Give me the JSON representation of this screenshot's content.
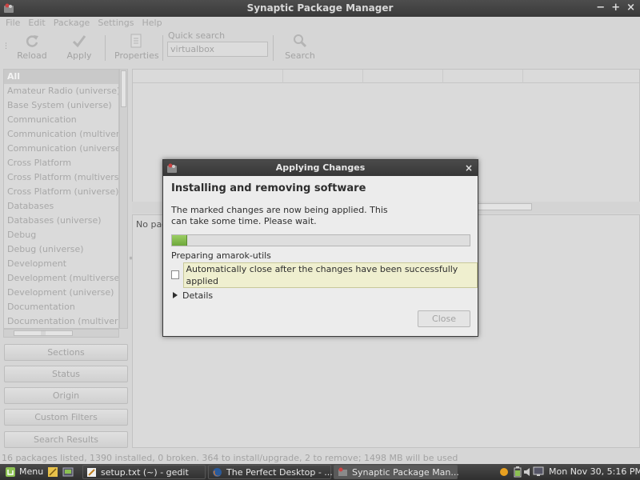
{
  "window": {
    "title": "Synaptic Package Manager",
    "controls": [
      "−",
      "+",
      "×"
    ]
  },
  "menu": [
    "File",
    "Edit",
    "Package",
    "Settings",
    "Help"
  ],
  "toolbar": {
    "reload": "Reload",
    "apply": "Apply",
    "properties": "Properties",
    "quick_search_label": "Quick search",
    "quick_search_value": "virtualbox",
    "search": "Search"
  },
  "sections_list": [
    "All",
    "Amateur Radio (universe)",
    "Base System (universe)",
    "Communication",
    "Communication (multiverse)",
    "Communication (universe)",
    "Cross Platform",
    "Cross Platform (multiverse)",
    "Cross Platform (universe)",
    "Databases",
    "Databases (universe)",
    "Debug",
    "Debug (universe)",
    "Development",
    "Development (multiverse)",
    "Development (universe)",
    "Documentation",
    "Documentation (multiverse)"
  ],
  "side_buttons": {
    "sections": "Sections",
    "status": "Status",
    "origin": "Origin",
    "custom_filters": "Custom Filters",
    "search_results": "Search Results"
  },
  "desc_panel": {
    "text": "No pac"
  },
  "status_bar": "16 packages listed, 1390 installed, 0 broken. 364 to install/upgrade, 2 to remove; 1498 MB will be used",
  "dialog": {
    "title": "Applying Changes",
    "heading": "Installing and removing software",
    "message": "The marked changes are now being applied. This can take some time. Please wait.",
    "progress": 0.05,
    "progress_text": "Preparing amarok-utils",
    "auto_close_label": "Automatically close after the changes have been successfully applied",
    "auto_close_checked": false,
    "details_label": "Details",
    "close_button": "Close"
  },
  "taskbar": {
    "menu": "Menu",
    "tasks": [
      "setup.txt (~) - gedit",
      "The Perfect Desktop - ...",
      "Synaptic Package Man..."
    ],
    "clock": "Mon Nov 30,  5:16 PM"
  }
}
